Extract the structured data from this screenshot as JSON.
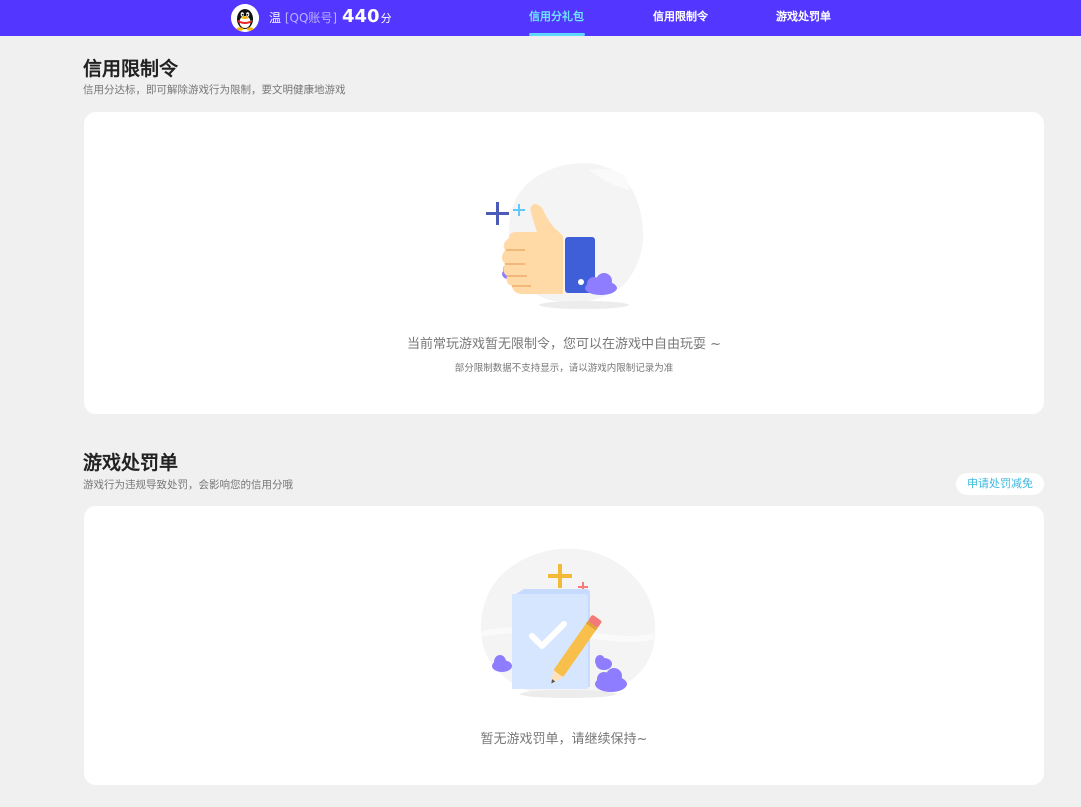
{
  "header": {
    "user_name": "温",
    "account_tag": "[QQ账号]",
    "score_value": "440",
    "score_unit": "分",
    "avatar_icon": "qq-penguin-icon",
    "tabs": [
      {
        "label": "信用分礼包",
        "active": true
      },
      {
        "label": "信用限制令",
        "active": false
      },
      {
        "label": "游戏处罚单",
        "active": false
      }
    ]
  },
  "restriction": {
    "title": "信用限制令",
    "subtitle": "信用分达标，即可解除游戏行为限制，要文明健康地游戏",
    "empty_text": "当前常玩游戏暂无限制令，您可以在游戏中自由玩耍 ~",
    "empty_note": "部分限制数据不支持显示，请以游戏内限制记录为准",
    "illustration_icon": "thumbs-up-icon"
  },
  "penalty": {
    "title": "游戏处罚单",
    "subtitle": "游戏行为违规导致处罚，会影响您的信用分哦",
    "apply_label": "申请处罚减免",
    "empty_text": "暂无游戏罚单，请继续保持~",
    "illustration_icon": "document-check-icon"
  },
  "colors": {
    "brand": "#5336ff",
    "active_tab": "#6ee2ff",
    "apply_text": "#3cb8e0",
    "background": "#f0f0f0"
  }
}
